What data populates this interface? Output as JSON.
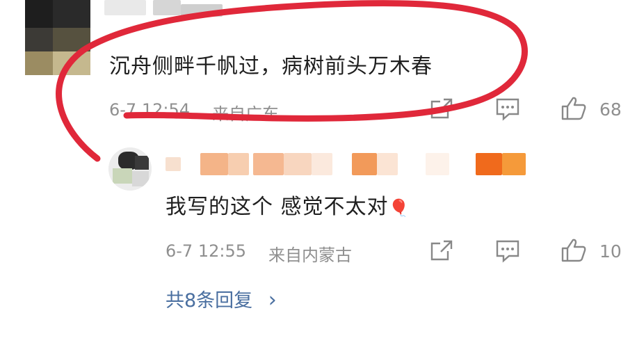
{
  "comment": {
    "text": "沉舟侧畔千帆过，病树前头万木春",
    "time": "6-7 12:54",
    "location": "来自广东",
    "like_count": "68"
  },
  "reply": {
    "text": "我写的这个 感觉不太对",
    "emoji": "🎈",
    "time": "6-7 12:55",
    "location": "来自内蒙古",
    "like_count": "10"
  },
  "more_replies": {
    "label": "共8条回复",
    "chevron": "›"
  },
  "icons": [
    "share-icon",
    "comment-icon",
    "like-icon",
    "chevron-right-icon"
  ],
  "colors": {
    "annotation_red": "#e0283a",
    "link_blue": "#4a6fa0",
    "meta_gray": "#8f8f8f"
  }
}
